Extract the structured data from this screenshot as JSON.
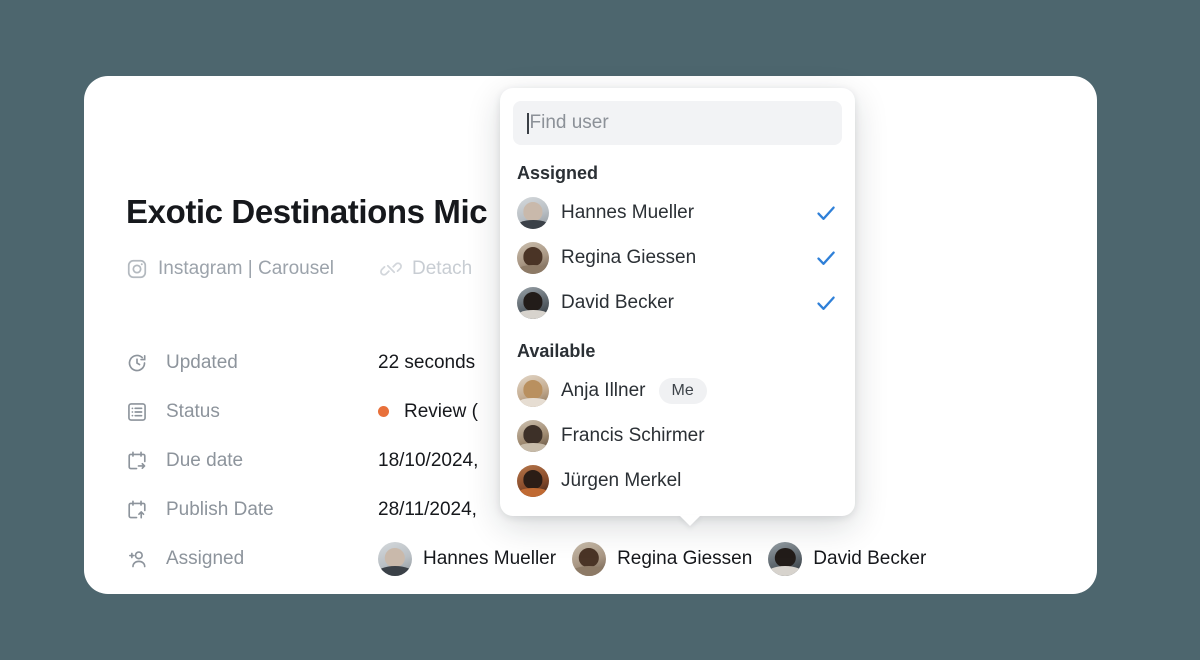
{
  "theme": {
    "page_background": "#4d666e",
    "card_background": "#ffffff",
    "accent_check": "#2f80d8",
    "status_dot": "#e8703a",
    "muted_text": "#8d949c"
  },
  "card": {
    "title": "Exotic Destinations Mic",
    "subtitle": {
      "channel_icon": "instagram-icon",
      "channel": "Instagram | Carousel",
      "detach_icon": "broken-link-icon",
      "detach_label": "Detach"
    },
    "meta_rows": [
      {
        "icon": "clock-refresh-icon",
        "label": "Updated",
        "value": "22 seconds",
        "has_dot": false
      },
      {
        "icon": "list-icon",
        "label": "Status",
        "value": "Review (",
        "has_dot": true
      },
      {
        "icon": "calendar-due-icon",
        "label": "Due date",
        "value": "18/10/2024,",
        "has_dot": false
      },
      {
        "icon": "calendar-publish-icon",
        "label": "Publish Date",
        "value": "28/11/2024,",
        "has_dot": false
      }
    ],
    "assigned_row": {
      "icon": "user-plus-icon",
      "label": "Assigned",
      "people": [
        {
          "name": "Hannes Mueller",
          "avatar": "av-hannes"
        },
        {
          "name": "Regina Giessen",
          "avatar": "av-regina"
        },
        {
          "name": "David Becker",
          "avatar": "av-david"
        }
      ]
    }
  },
  "popup": {
    "search": {
      "placeholder": "Find user",
      "value": ""
    },
    "groups": [
      {
        "title": "Assigned",
        "users": [
          {
            "name": "Hannes Mueller",
            "avatar": "av-hannes",
            "checked": true,
            "badge": ""
          },
          {
            "name": "Regina Giessen",
            "avatar": "av-regina",
            "checked": true,
            "badge": ""
          },
          {
            "name": "David Becker",
            "avatar": "av-david",
            "checked": true,
            "badge": ""
          }
        ]
      },
      {
        "title": "Available",
        "users": [
          {
            "name": "Anja Illner",
            "avatar": "av-anja",
            "checked": false,
            "badge": "Me"
          },
          {
            "name": "Francis Schirmer",
            "avatar": "av-francis",
            "checked": false,
            "badge": ""
          },
          {
            "name": "Jürgen Merkel",
            "avatar": "av-jurgen",
            "checked": false,
            "badge": ""
          }
        ]
      }
    ]
  }
}
